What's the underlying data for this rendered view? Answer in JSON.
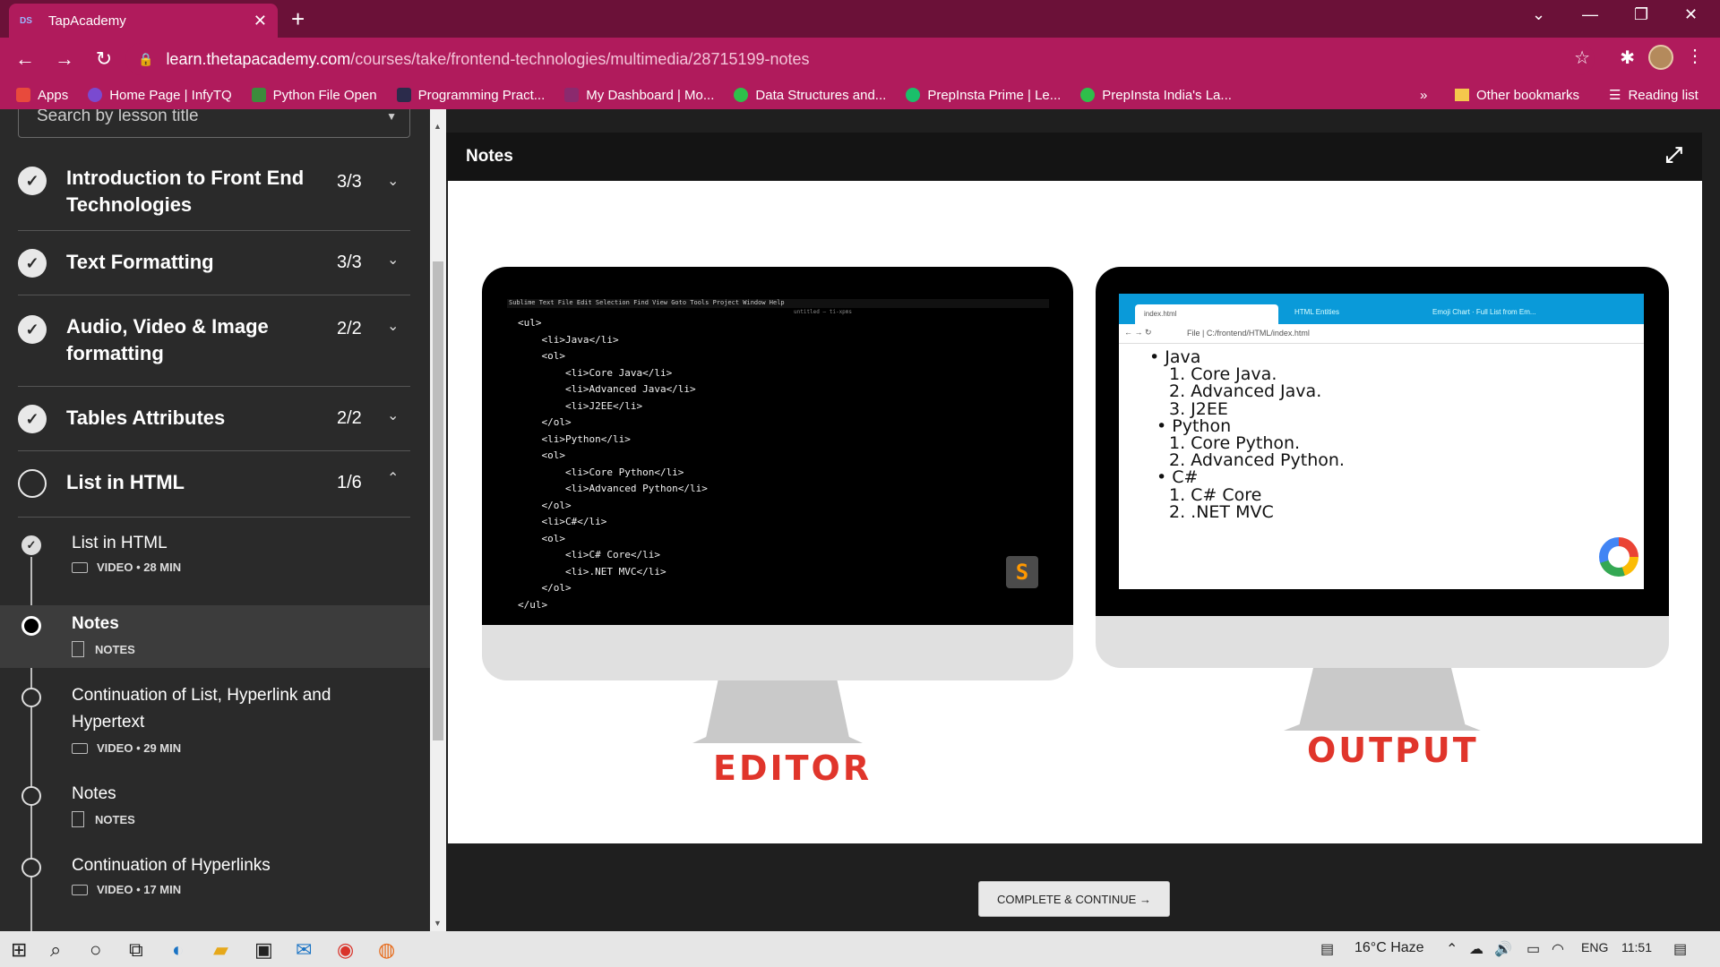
{
  "browser": {
    "tab_title": "TapAcademy",
    "url_domain": "learn.thetapacademy.com",
    "url_path": "/courses/take/frontend-technologies/multimedia/28715199-notes",
    "bookmarks": [
      "Apps",
      "Home Page | InfyTQ",
      "Python File Open",
      "Programming Pract...",
      "My Dashboard | Mo...",
      "Data Structures and...",
      "PrepInsta Prime | Le...",
      "PrepInsta India's La..."
    ],
    "more_bookmarks": "»",
    "other_bookmarks": "Other bookmarks",
    "reading_list": "Reading list",
    "colors": {
      "titlebar": "#6b1138",
      "toolbar": "#b01b5c"
    }
  },
  "sidebar": {
    "search_placeholder": "Search by lesson title",
    "sections": [
      {
        "title": "Introduction to Front End Technologies",
        "count": "3/3",
        "done": true,
        "expanded": false
      },
      {
        "title": "Text Formatting",
        "count": "3/3",
        "done": true,
        "expanded": false
      },
      {
        "title": "Audio, Video & Image formatting",
        "count": "2/2",
        "done": true,
        "expanded": false
      },
      {
        "title": "Tables Attributes",
        "count": "2/2",
        "done": true,
        "expanded": false
      },
      {
        "title": "List in HTML",
        "count": "1/6",
        "done": false,
        "expanded": true
      }
    ],
    "lessons": [
      {
        "title": "List in HTML",
        "meta": "VIDEO • 28 MIN",
        "type": "video",
        "done": true,
        "active": false
      },
      {
        "title": "Notes",
        "meta": "NOTES",
        "type": "notes",
        "done": false,
        "active": true
      },
      {
        "title": "Continuation of List, Hyperlink and Hypertext",
        "meta": "VIDEO • 29 MIN",
        "type": "video",
        "done": false,
        "active": false
      },
      {
        "title": "Notes",
        "meta": "NOTES",
        "type": "notes",
        "done": false,
        "active": false
      },
      {
        "title": "Continuation of Hyperlinks",
        "meta": "VIDEO • 17 MIN",
        "type": "video",
        "done": false,
        "active": false
      }
    ]
  },
  "main": {
    "header": "Notes",
    "editor_label": "EDITOR",
    "output_label": "OUTPUT",
    "editor_menu": "Sublime Text   File   Edit   Selection   Find   View   Goto   Tools   Project   Window   Help",
    "editor_subtitle": "untitled — ti-xpms",
    "code_lines": [
      "<ul>",
      "    <li>Java</li>",
      "    <ol>",
      "        <li>Core Java</li>",
      "        <li>Advanced Java</li>",
      "        <li>J2EE</li>",
      "    </ol>",
      "    <li>Python</li>",
      "    <ol>",
      "        <li>Core Python</li>",
      "        <li>Advanced Python</li>",
      "    </ol>",
      "    <li>C#</li>",
      "    <ol>",
      "        <li>C# Core</li>",
      "        <li>.NET MVC</li>",
      "    </ol>",
      "</ul>"
    ],
    "output_tab": "index.html",
    "output_tab2": "HTML Entities",
    "output_tab3": "Emoji Chart · Full List from Em...",
    "output_addr": "File  |  C:/frontend/HTML/index.html",
    "output_lines": [
      {
        "text": "• Java",
        "indent": 0
      },
      {
        "text": "1. Core Java.",
        "indent": 2
      },
      {
        "text": "2. Advanced Java.",
        "indent": 2
      },
      {
        "text": "3. J2EE",
        "indent": 2
      },
      {
        "text": "• Python",
        "indent": 1
      },
      {
        "text": "1. Core Python.",
        "indent": 2
      },
      {
        "text": "2. Advanced Python.",
        "indent": 2
      },
      {
        "text": "• C#",
        "indent": 1
      },
      {
        "text": "1. C# Core",
        "indent": 2
      },
      {
        "text": "2. .NET MVC",
        "indent": 2
      }
    ],
    "complete_button": "COMPLETE & CONTINUE →"
  },
  "taskbar": {
    "weather": "16°C  Haze",
    "lang": "ENG",
    "time": "11:51"
  }
}
